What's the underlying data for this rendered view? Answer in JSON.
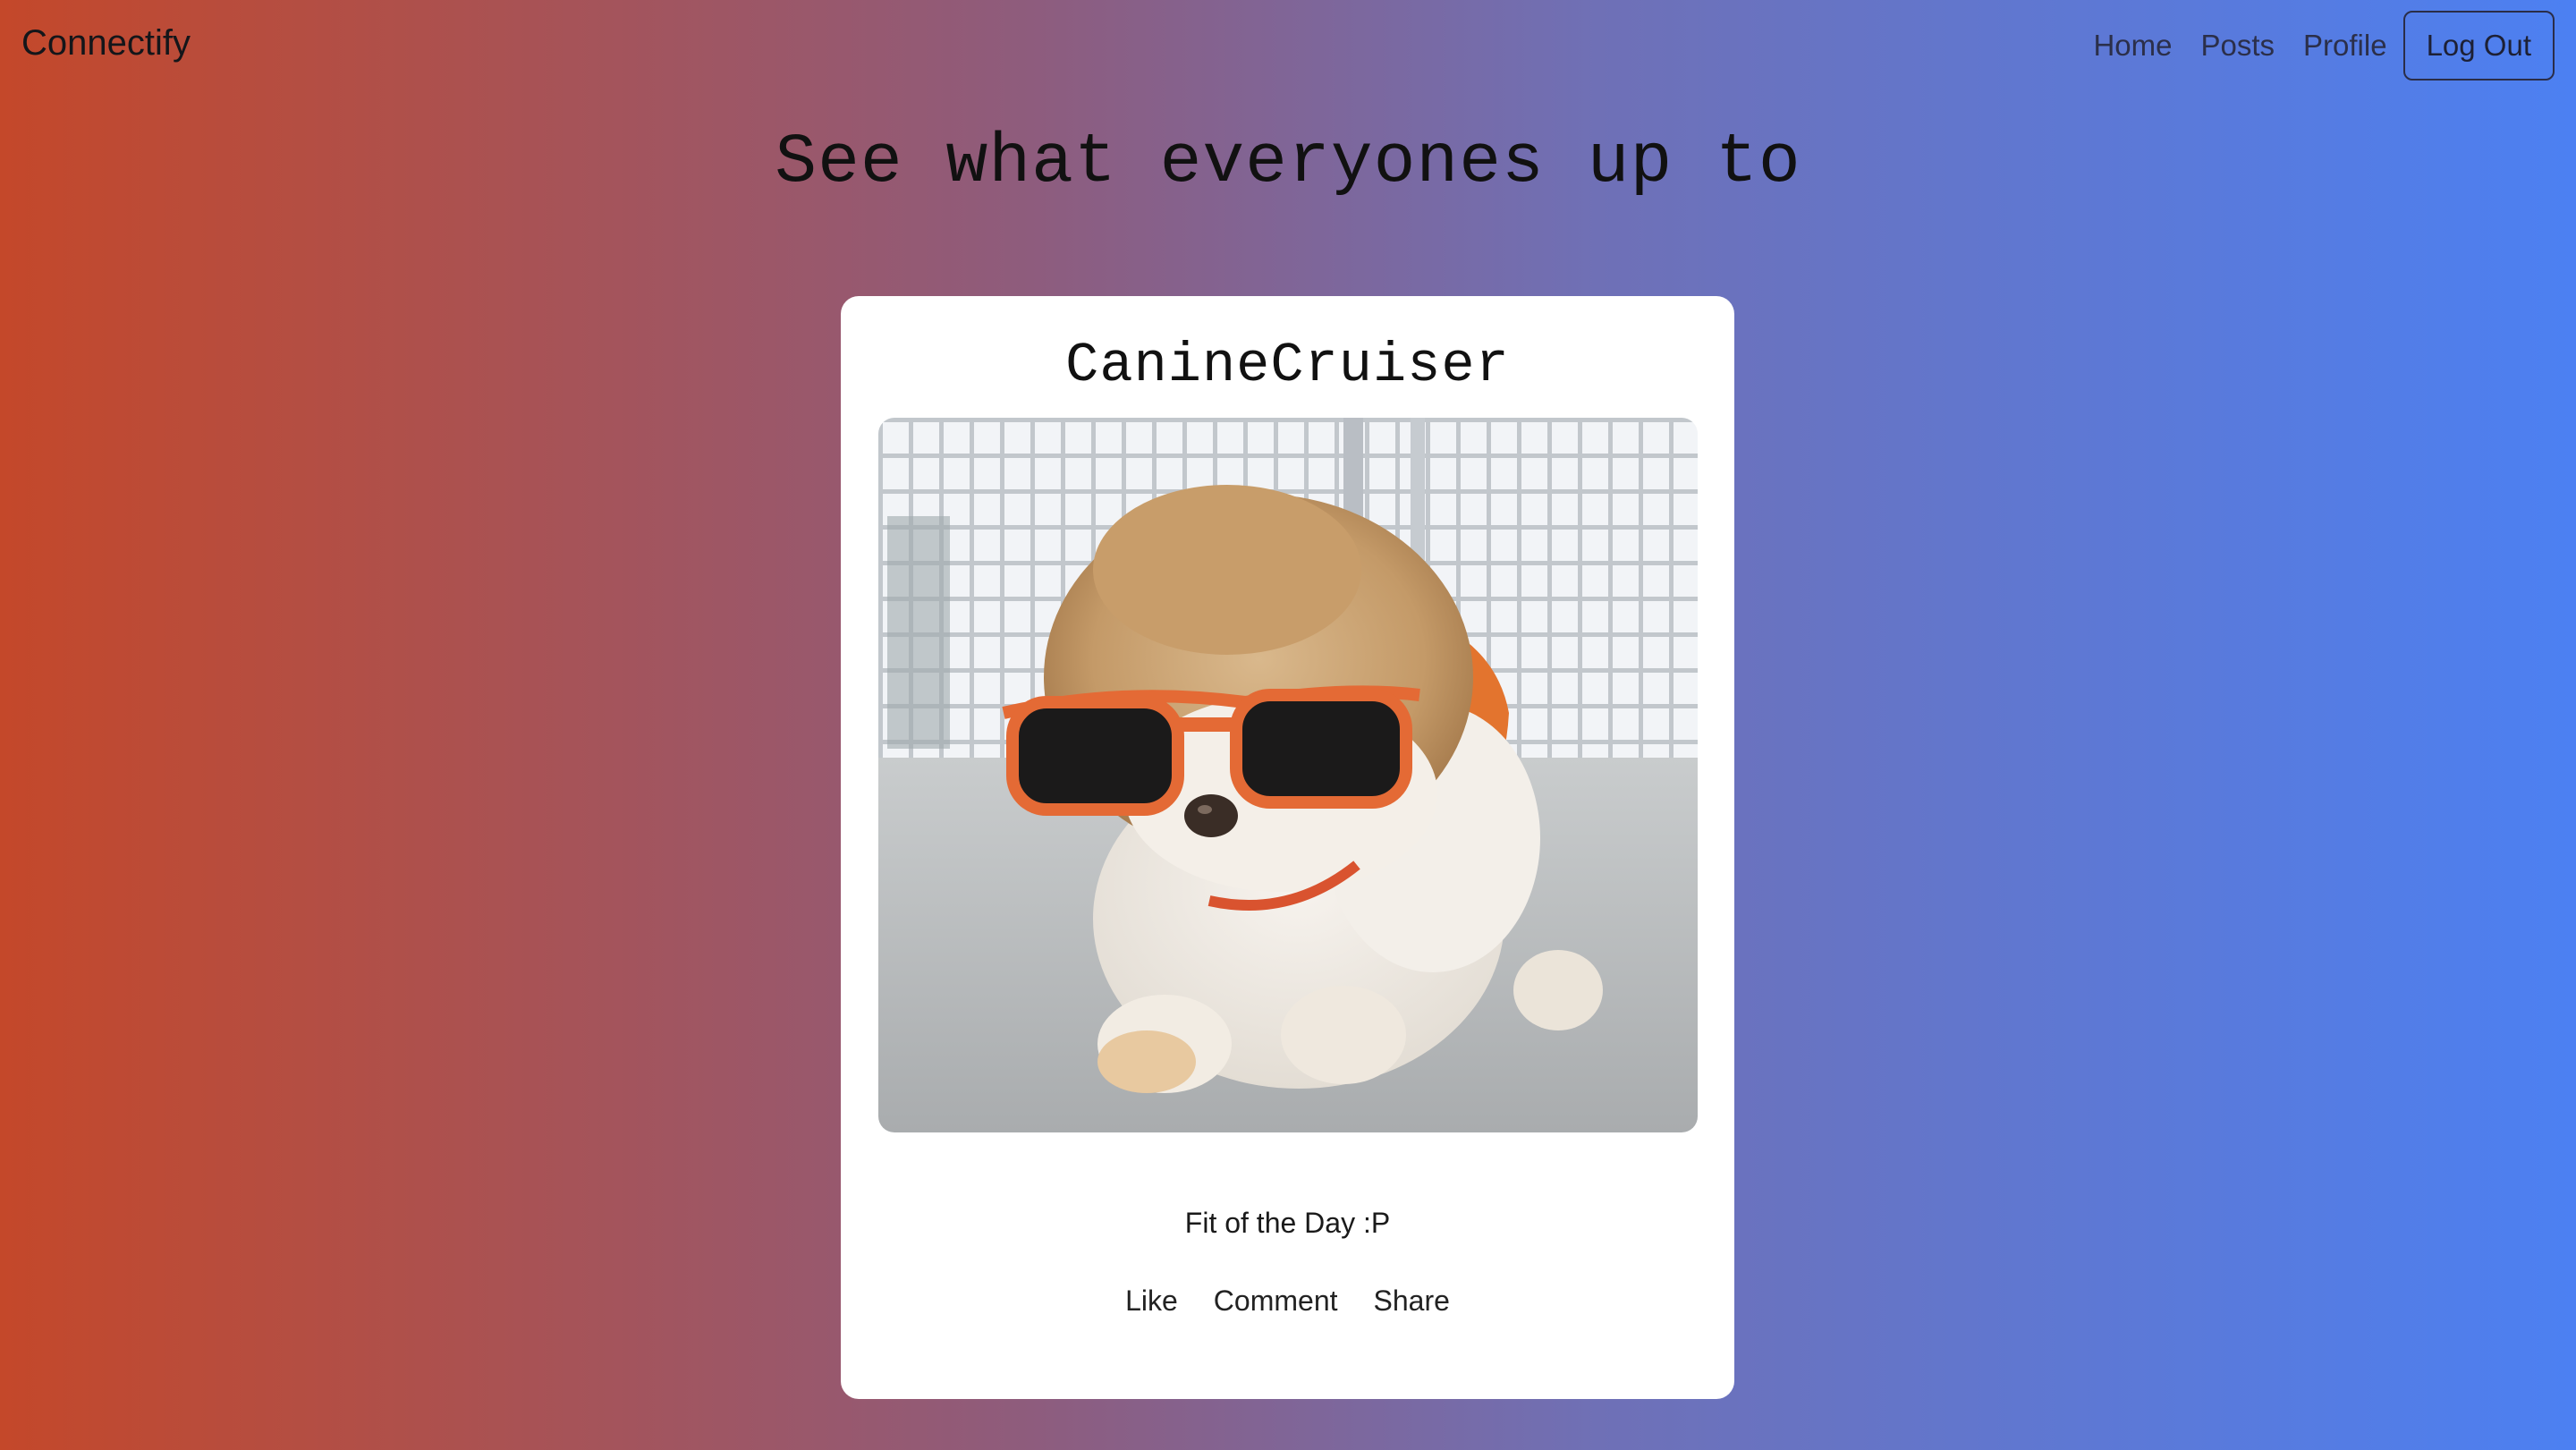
{
  "navbar": {
    "brand": "Connectify",
    "links": [
      "Home",
      "Posts",
      "Profile"
    ],
    "logout_label": "Log Out"
  },
  "feed": {
    "heading": "See what everyones up to"
  },
  "post": {
    "username": "CanineCruiser",
    "image_subject": "dog-with-sunglasses-photo",
    "caption": "Fit of the Day :P",
    "actions": [
      "Like",
      "Comment",
      "Share"
    ]
  },
  "colors": {
    "gradient_left": "#c4482a",
    "gradient_right": "#4c80f2",
    "card_background": "#ffffff"
  }
}
